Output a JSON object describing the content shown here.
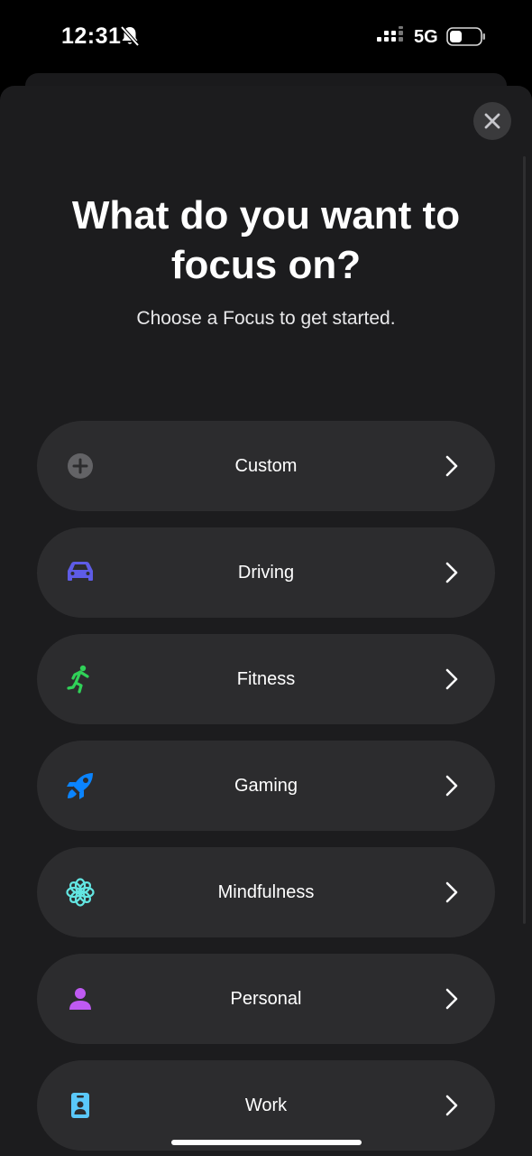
{
  "status_bar": {
    "time": "12:31",
    "network": "5G",
    "icons": [
      "bell-slash-icon",
      "signal-icon",
      "battery-icon"
    ]
  },
  "sheet": {
    "title": "What do you want to focus on?",
    "subtitle": "Choose a Focus to get started.",
    "close_icon": "close-icon"
  },
  "focus_options": [
    {
      "label": "Custom",
      "icon": "plus-circle-icon",
      "color": "#636366"
    },
    {
      "label": "Driving",
      "icon": "car-icon",
      "color": "#5e5ce6"
    },
    {
      "label": "Fitness",
      "icon": "running-figure-icon",
      "color": "#30d158"
    },
    {
      "label": "Gaming",
      "icon": "rocket-icon",
      "color": "#0a84ff"
    },
    {
      "label": "Mindfulness",
      "icon": "flower-icon",
      "color": "#63e6e2"
    },
    {
      "label": "Personal",
      "icon": "person-icon",
      "color": "#bf5af2"
    },
    {
      "label": "Work",
      "icon": "id-badge-icon",
      "color": "#5ac8fa"
    }
  ]
}
